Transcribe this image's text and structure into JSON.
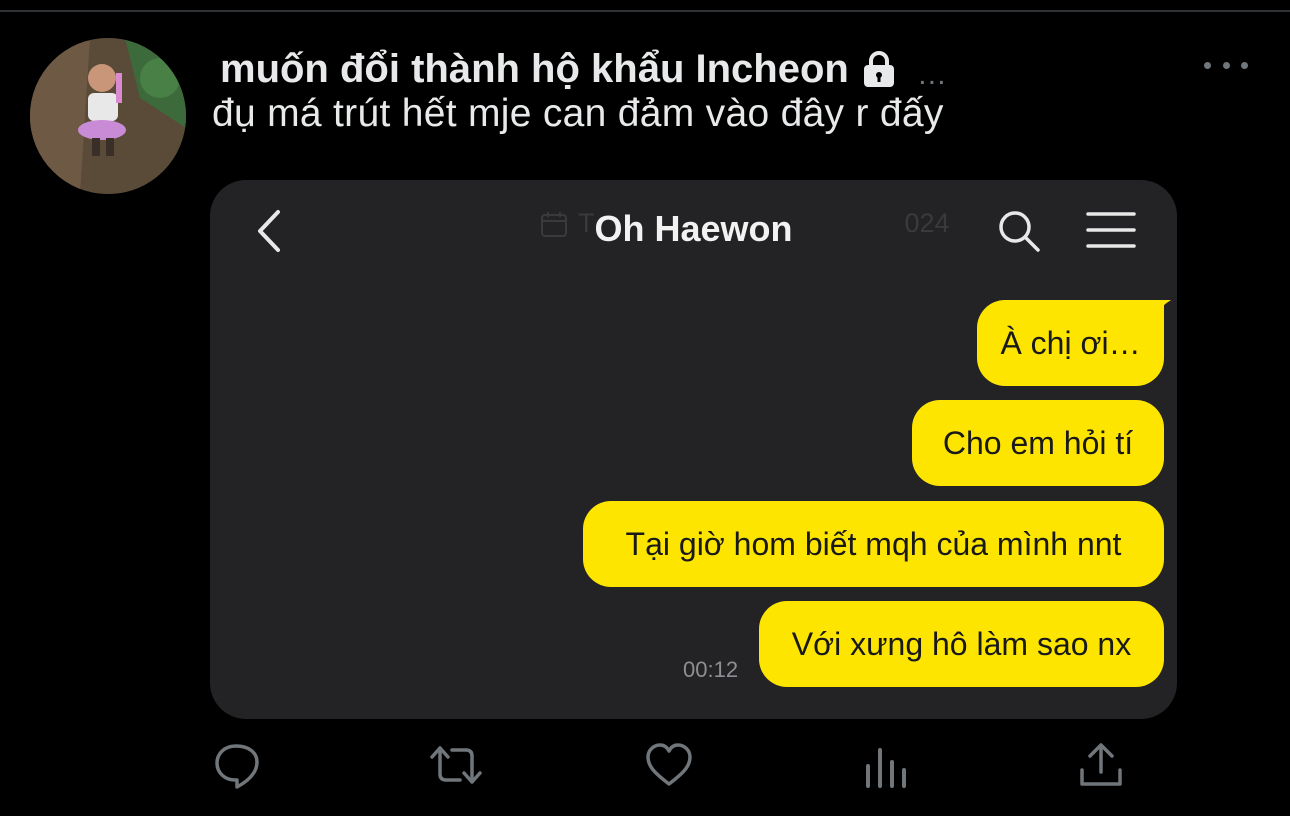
{
  "tweet": {
    "display_name": "muốn đổi thành hộ khẩu Incheon",
    "more_inline": "…",
    "text": "đụ má trút hết mje can đảm vào đây r đấy"
  },
  "chat": {
    "title": "Oh Haewon",
    "ghost_date_left": "T",
    "ghost_date_right": "024",
    "messages": [
      "À chị ơi…",
      "Cho em hỏi tí",
      "Tại giờ hom biết mqh của mình nnt",
      "Với xưng hô làm sao nx"
    ],
    "timestamp": "00:12",
    "bubble_color": "#fee500"
  },
  "icons": {
    "avatar": "profile-avatar",
    "lock": "lock-icon",
    "more": "more-horizontal-icon",
    "back": "chevron-left-icon",
    "search": "search-icon",
    "menu": "hamburger-menu-icon",
    "reply": "reply-icon",
    "retweet": "retweet-icon",
    "like": "heart-icon",
    "views": "analytics-icon",
    "share": "share-icon"
  },
  "colors": {
    "background": "#000000",
    "text": "#e7e9ea",
    "muted": "#71767b",
    "card": "#232325"
  }
}
